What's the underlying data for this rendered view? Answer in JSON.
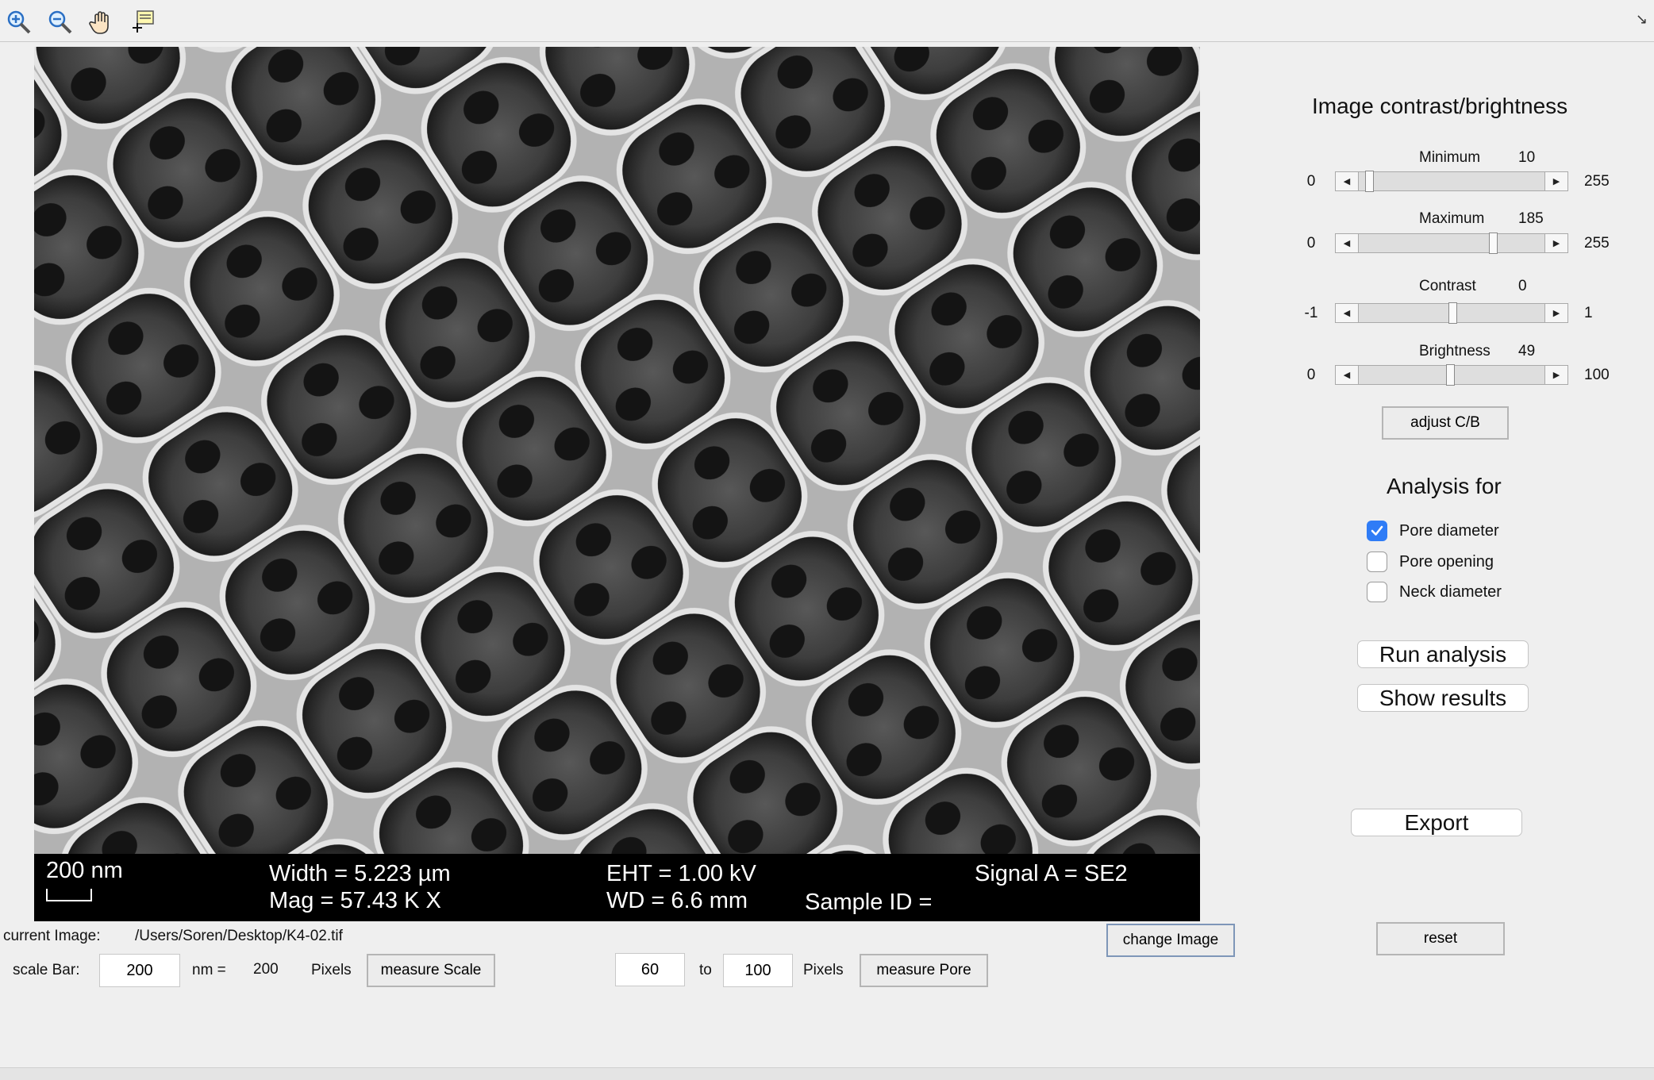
{
  "toolbar": {
    "icons": [
      "zoom-in-icon",
      "zoom-out-icon",
      "pan-hand-icon",
      "data-cursor-icon"
    ]
  },
  "sem_image": {
    "scale_label": "200 nm",
    "width": "Width = 5.223 µm",
    "mag": "Mag =  57.43 K X",
    "eht": "EHT =  1.00 kV",
    "wd": "WD =  6.6 mm",
    "sample_id": "Sample ID =",
    "signal": "Signal A = SE2"
  },
  "file": {
    "current_image_label": "current Image:",
    "path": "/Users/Soren/Desktop/K4-02.tif",
    "change_button": "change Image"
  },
  "scale": {
    "label": "scale Bar:",
    "nm_value": "200",
    "nm_eq": "nm =",
    "pixels_value": "200",
    "pixels_label": "Pixels",
    "measure_button": "measure Scale"
  },
  "pore_range": {
    "min": "60",
    "to": "to",
    "max": "100",
    "pixels_label": "Pixels",
    "measure_button": "measure Pore"
  },
  "panel": {
    "title": "Image contrast/brightness",
    "sliders": [
      {
        "label": "Minimum",
        "value": "10",
        "min": "0",
        "max": "255",
        "fraction": 0.039
      },
      {
        "label": "Maximum",
        "value": "185",
        "min": "0",
        "max": "255",
        "fraction": 0.725
      },
      {
        "label": "Contrast",
        "value": "0",
        "min": "-1",
        "max": "1",
        "fraction": 0.5
      },
      {
        "label": "Brightness",
        "value": "49",
        "min": "0",
        "max": "100",
        "fraction": 0.49
      }
    ],
    "adjust_button": "adjust C/B",
    "analysis_title": "Analysis for",
    "checks": [
      {
        "label": "Pore diameter",
        "checked": true
      },
      {
        "label": "Pore opening",
        "checked": false
      },
      {
        "label": "Neck diameter",
        "checked": false
      }
    ],
    "run_button": "Run analysis",
    "results_button": "Show results",
    "export_button": "Export",
    "reset_button": "reset"
  }
}
